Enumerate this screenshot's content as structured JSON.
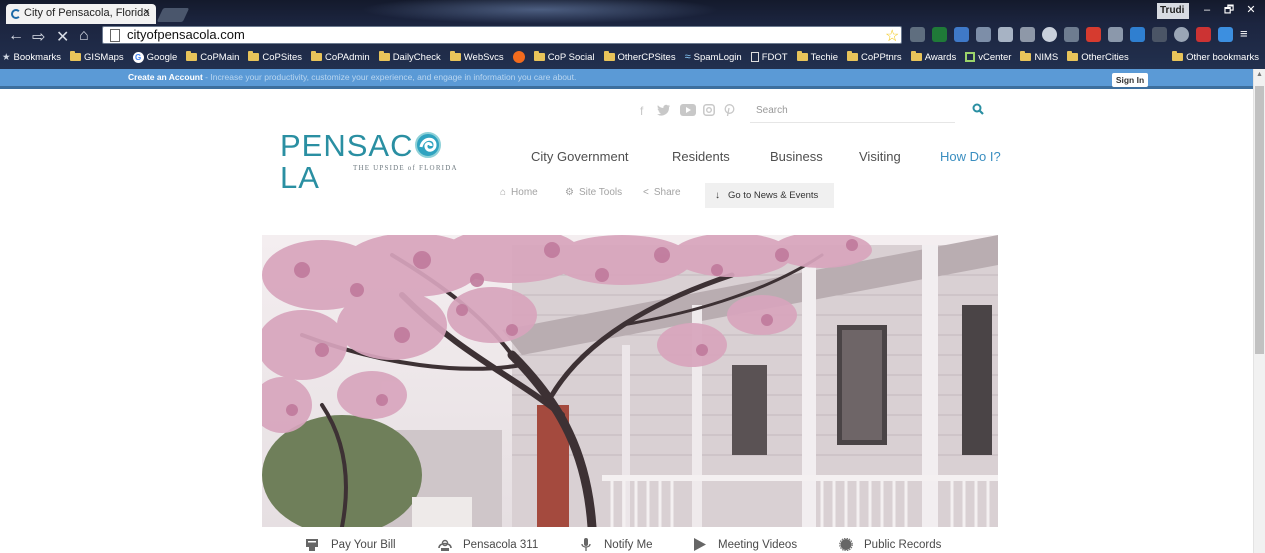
{
  "browser": {
    "tab_title": "City of Pensacola, Florida",
    "tab_close": "×",
    "user_name": "Trudi",
    "window_controls": [
      "–",
      "🗗",
      "✕"
    ],
    "url": "cityofpensacola.com",
    "nav": {
      "back": "←",
      "forward": "⇨",
      "stop": "✕",
      "home": "⌂"
    },
    "star": "☆",
    "bookmarks": [
      {
        "label": "Bookmarks",
        "icon": "star-icon"
      },
      {
        "label": "GISMaps",
        "icon": "folder-icon"
      },
      {
        "label": "Google",
        "icon": "google-icon"
      },
      {
        "label": "CoPMain",
        "icon": "folder-icon"
      },
      {
        "label": "CoPSites",
        "icon": "folder-icon"
      },
      {
        "label": "CoPAdmin",
        "icon": "folder-icon"
      },
      {
        "label": "DailyCheck",
        "icon": "folder-icon"
      },
      {
        "label": "WebSvcs",
        "icon": "folder-icon"
      },
      {
        "label": "",
        "icon": "orange-circle-icon"
      },
      {
        "label": "CoP Social",
        "icon": "folder-icon"
      },
      {
        "label": "OtherCPSites",
        "icon": "folder-icon"
      },
      {
        "label": "SpamLogin",
        "icon": "spam-icon"
      },
      {
        "label": "FDOT",
        "icon": "page-icon"
      },
      {
        "label": "Techie",
        "icon": "folder-icon"
      },
      {
        "label": "CoPPtnrs",
        "icon": "folder-icon"
      },
      {
        "label": "Awards",
        "icon": "folder-icon"
      },
      {
        "label": "vCenter",
        "icon": "vcenter-icon"
      },
      {
        "label": "NIMS",
        "icon": "folder-icon"
      },
      {
        "label": "OtherCities",
        "icon": "folder-icon"
      }
    ],
    "other_bookmarks": "Other bookmarks"
  },
  "account_bar": {
    "create_label": "Create an Account",
    "tagline": " - Increase your productivity, customize your experience, and engage in information you care about.",
    "signin_label": "Sign In"
  },
  "social": {
    "facebook": "f",
    "twitter": "🐦",
    "youtube": "▶",
    "instagram": "◻",
    "pinterest": "℗"
  },
  "search": {
    "placeholder": "Search"
  },
  "logo": {
    "text_left": "PENSAC",
    "text_right": "LA",
    "tagline": "THE UPSIDE of FLORIDA"
  },
  "mainnav": [
    "City Government",
    "Residents",
    "Business",
    "Visiting",
    "How Do I?"
  ],
  "subnav": {
    "home": "Home",
    "site_tools": "Site Tools",
    "share": "Share",
    "news": "Go to News & Events"
  },
  "quicklinks": [
    "Pay Your Bill",
    "Pensacola 311",
    "Notify Me",
    "Meeting Videos",
    "Public Records"
  ],
  "colors": {
    "account_bar": "#5b9ad6",
    "logo_teal": "#2a8fa2",
    "howdo_blue": "#3a8ec0"
  }
}
